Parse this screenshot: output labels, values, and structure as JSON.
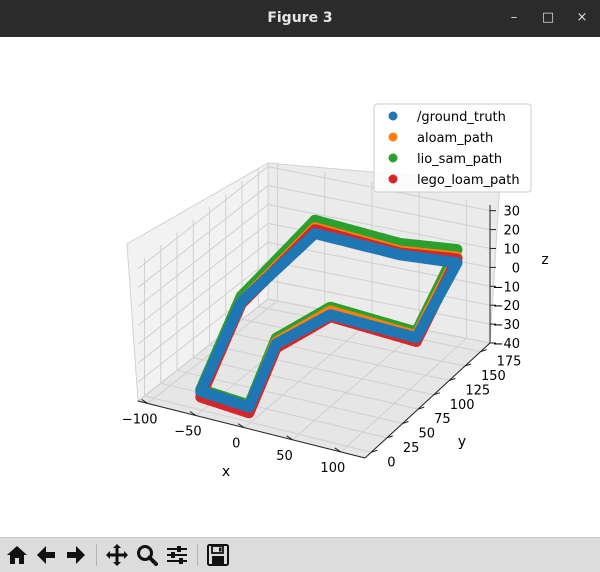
{
  "window": {
    "title": "Figure 3",
    "controls": {
      "minimize": "–",
      "maximize": "□",
      "close": "×"
    }
  },
  "toolbar": {
    "items": [
      "home-icon",
      "back-arrow-icon",
      "forward-arrow-icon",
      "pan-icon",
      "zoom-icon",
      "configure-subplots-icon",
      "save-icon"
    ]
  },
  "chart_data": {
    "type": "scatter",
    "projection": "3d",
    "xlabel": "x",
    "ylabel": "y",
    "zlabel": "z",
    "x_ticks": [
      -100,
      -50,
      0,
      50,
      100
    ],
    "y_ticks": [
      0,
      25,
      50,
      75,
      100,
      125,
      150,
      175
    ],
    "z_ticks": [
      30,
      20,
      10,
      0,
      -10,
      -20,
      -30,
      -40
    ],
    "xlim": [
      -110,
      125
    ],
    "ylim": [
      -10,
      190
    ],
    "zlim": [
      -40,
      33
    ],
    "grid": true,
    "legend_position": "top-right",
    "colors": [
      "#1f77b4",
      "#ff7f0e",
      "#2ca02c",
      "#d62728"
    ],
    "series": [
      {
        "name": "/ground_truth",
        "color": "#1f77b4",
        "x": [
          -5,
          -55,
          -70,
          -40,
          50,
          110,
          110,
          20,
          0,
          -5
        ],
        "y": [
          5,
          5,
          90,
          160,
          160,
          160,
          95,
          95,
          40,
          5
        ],
        "z": [
          -34,
          -32,
          -10,
          10,
          8,
          10,
          -10,
          -8,
          -10,
          -34
        ]
      },
      {
        "name": "aloam_path",
        "color": "#ff7f0e",
        "x": [
          -5,
          -55,
          -70,
          -40,
          50,
          110,
          110,
          20,
          0,
          -5
        ],
        "y": [
          5,
          5,
          90,
          160,
          160,
          160,
          95,
          95,
          40,
          5
        ],
        "z": [
          -35,
          -33,
          -10,
          13,
          10,
          13,
          -9,
          -6,
          -9,
          -35
        ]
      },
      {
        "name": "lio_sam_path",
        "color": "#2ca02c",
        "x": [
          -5,
          -55,
          -70,
          -40,
          50,
          110,
          110,
          20,
          0,
          -5
        ],
        "y": [
          5,
          5,
          90,
          160,
          160,
          160,
          95,
          95,
          40,
          5
        ],
        "z": [
          -33,
          -31,
          -7,
          17,
          14,
          17,
          -7,
          -4,
          -7,
          -33
        ]
      },
      {
        "name": "lego_loam_path",
        "color": "#d62728",
        "x": [
          -5,
          -55,
          -70,
          -40,
          50,
          110,
          110,
          20,
          0,
          -5
        ],
        "y": [
          5,
          5,
          90,
          160,
          160,
          160,
          95,
          95,
          40,
          5
        ],
        "z": [
          -37,
          -35,
          -11,
          12,
          9,
          12,
          -12,
          -9,
          -12,
          -37
        ]
      }
    ]
  }
}
